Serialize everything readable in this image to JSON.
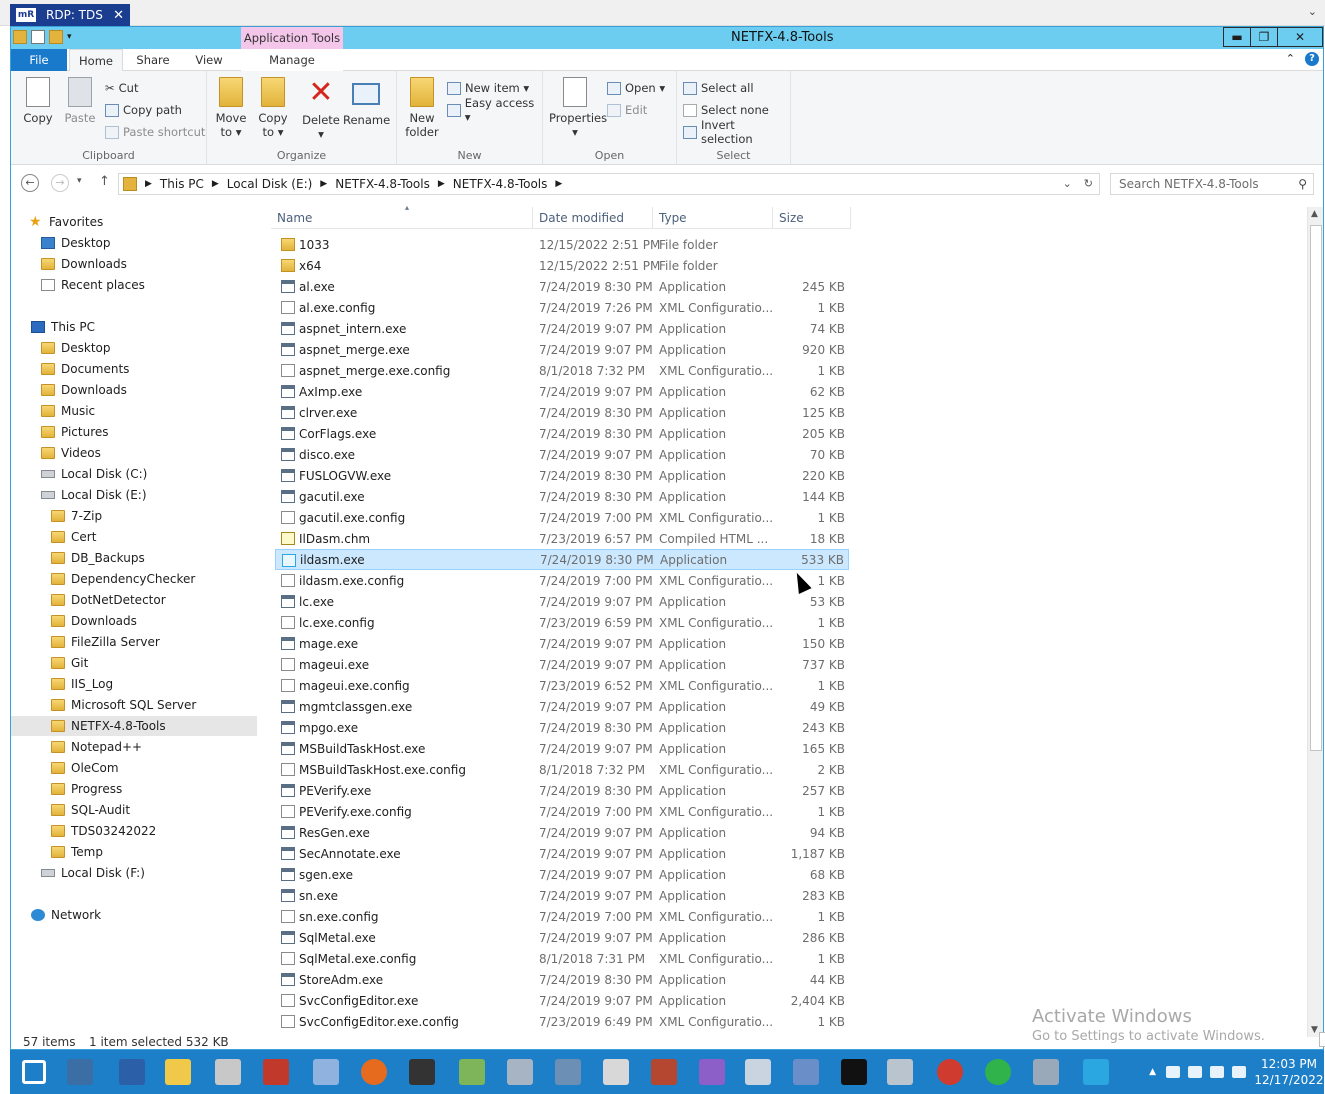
{
  "rdp": {
    "tab_label": "RDP: TDS",
    "logo": "mR",
    "close": "✕",
    "chevron": "⌄"
  },
  "window": {
    "title": "NETFX-4.8-Tools",
    "contextual_tab": "Application Tools",
    "buttons": {
      "minimize": "▬",
      "restore": "❐",
      "close": "✕"
    }
  },
  "tabs": {
    "file": "File",
    "home": "Home",
    "share": "Share",
    "view": "View",
    "manage": "Manage",
    "collapse": "⌃",
    "help": "?"
  },
  "ribbon": {
    "clipboard": {
      "label": "Clipboard",
      "copy": "Copy",
      "paste": "Paste",
      "cut": "Cut",
      "copy_path": "Copy path",
      "paste_shortcut": "Paste shortcut"
    },
    "organize": {
      "label": "Organize",
      "move_to_1": "Move",
      "move_to_2": "to ▾",
      "copy_to_1": "Copy",
      "copy_to_2": "to ▾",
      "delete_1": "Delete",
      "delete_2": "▾",
      "rename": "Rename"
    },
    "new": {
      "label": "New",
      "new_folder_1": "New",
      "new_folder_2": "folder",
      "new_item": "New item ▾",
      "easy_access": "Easy access ▾"
    },
    "open": {
      "label": "Open",
      "properties_1": "Properties",
      "properties_2": "▾",
      "open": "Open ▾",
      "edit": "Edit"
    },
    "select": {
      "label": "Select",
      "select_all": "Select all",
      "select_none": "Select none",
      "invert": "Invert selection"
    }
  },
  "address": {
    "crumbs": [
      "This PC",
      "Local Disk (E:)",
      "NETFX-4.8-Tools",
      "NETFX-4.8-Tools"
    ],
    "search_placeholder": "Search NETFX-4.8-Tools"
  },
  "nav": {
    "favorites": "Favorites",
    "fav_desktop": "Desktop",
    "fav_downloads": "Downloads",
    "fav_recent": "Recent places",
    "thispc": "This PC",
    "pc_desktop": "Desktop",
    "pc_documents": "Documents",
    "pc_downloads": "Downloads",
    "pc_music": "Music",
    "pc_pictures": "Pictures",
    "pc_videos": "Videos",
    "disk_c": "Local Disk (C:)",
    "disk_e": "Local Disk (E:)",
    "e_folders": [
      "7-Zip",
      "Cert",
      "DB_Backups",
      "DependencyChecker",
      "DotNetDetector",
      "Downloads",
      "FileZilla Server",
      "Git",
      "IIS_Log",
      "Microsoft SQL Server",
      "NETFX-4.8-Tools",
      "Notepad++",
      "OleCom",
      "Progress",
      "SQL-Audit",
      "TDS03242022",
      "Temp"
    ],
    "disk_f": "Local Disk (F:)",
    "network": "Network"
  },
  "columns": {
    "name": "Name",
    "date": "Date modified",
    "type": "Type",
    "size": "Size"
  },
  "files": [
    {
      "name": "1033",
      "date": "12/15/2022 2:51 PM",
      "type": "File folder",
      "size": "",
      "icon": "folder"
    },
    {
      "name": "x64",
      "date": "12/15/2022 2:51 PM",
      "type": "File folder",
      "size": "",
      "icon": "folder"
    },
    {
      "name": "al.exe",
      "date": "7/24/2019 8:30 PM",
      "type": "Application",
      "size": "245 KB",
      "icon": "app"
    },
    {
      "name": "al.exe.config",
      "date": "7/24/2019 7:26 PM",
      "type": "XML Configuratio...",
      "size": "1 KB",
      "icon": "cfg"
    },
    {
      "name": "aspnet_intern.exe",
      "date": "7/24/2019 9:07 PM",
      "type": "Application",
      "size": "74 KB",
      "icon": "app"
    },
    {
      "name": "aspnet_merge.exe",
      "date": "7/24/2019 9:07 PM",
      "type": "Application",
      "size": "920 KB",
      "icon": "app"
    },
    {
      "name": "aspnet_merge.exe.config",
      "date": "8/1/2018 7:32 PM",
      "type": "XML Configuratio...",
      "size": "1 KB",
      "icon": "cfg"
    },
    {
      "name": "AxImp.exe",
      "date": "7/24/2019 9:07 PM",
      "type": "Application",
      "size": "62 KB",
      "icon": "app"
    },
    {
      "name": "clrver.exe",
      "date": "7/24/2019 8:30 PM",
      "type": "Application",
      "size": "125 KB",
      "icon": "app"
    },
    {
      "name": "CorFlags.exe",
      "date": "7/24/2019 8:30 PM",
      "type": "Application",
      "size": "205 KB",
      "icon": "app"
    },
    {
      "name": "disco.exe",
      "date": "7/24/2019 9:07 PM",
      "type": "Application",
      "size": "70 KB",
      "icon": "app"
    },
    {
      "name": "FUSLOGVW.exe",
      "date": "7/24/2019 8:30 PM",
      "type": "Application",
      "size": "220 KB",
      "icon": "app"
    },
    {
      "name": "gacutil.exe",
      "date": "7/24/2019 8:30 PM",
      "type": "Application",
      "size": "144 KB",
      "icon": "app"
    },
    {
      "name": "gacutil.exe.config",
      "date": "7/24/2019 7:00 PM",
      "type": "XML Configuratio...",
      "size": "1 KB",
      "icon": "cfg"
    },
    {
      "name": "IlDasm.chm",
      "date": "7/23/2019 6:57 PM",
      "type": "Compiled HTML ...",
      "size": "18 KB",
      "icon": "chm"
    },
    {
      "name": "ildasm.exe",
      "date": "7/24/2019 8:30 PM",
      "type": "Application",
      "size": "533 KB",
      "icon": "bolt",
      "selected": true
    },
    {
      "name": "ildasm.exe.config",
      "date": "7/24/2019 7:00 PM",
      "type": "XML Configuratio...",
      "size": "1 KB",
      "icon": "cfg"
    },
    {
      "name": "lc.exe",
      "date": "7/24/2019 9:07 PM",
      "type": "Application",
      "size": "53 KB",
      "icon": "app"
    },
    {
      "name": "lc.exe.config",
      "date": "7/23/2019 6:59 PM",
      "type": "XML Configuratio...",
      "size": "1 KB",
      "icon": "cfg"
    },
    {
      "name": "mage.exe",
      "date": "7/24/2019 9:07 PM",
      "type": "Application",
      "size": "150 KB",
      "icon": "app"
    },
    {
      "name": "mageui.exe",
      "date": "7/24/2019 9:07 PM",
      "type": "Application",
      "size": "737 KB",
      "icon": "cfg"
    },
    {
      "name": "mageui.exe.config",
      "date": "7/23/2019 6:52 PM",
      "type": "XML Configuratio...",
      "size": "1 KB",
      "icon": "cfg"
    },
    {
      "name": "mgmtclassgen.exe",
      "date": "7/24/2019 9:07 PM",
      "type": "Application",
      "size": "49 KB",
      "icon": "app"
    },
    {
      "name": "mpgo.exe",
      "date": "7/24/2019 8:30 PM",
      "type": "Application",
      "size": "243 KB",
      "icon": "app"
    },
    {
      "name": "MSBuildTaskHost.exe",
      "date": "7/24/2019 9:07 PM",
      "type": "Application",
      "size": "165 KB",
      "icon": "app"
    },
    {
      "name": "MSBuildTaskHost.exe.config",
      "date": "8/1/2018 7:32 PM",
      "type": "XML Configuratio...",
      "size": "2 KB",
      "icon": "cfg"
    },
    {
      "name": "PEVerify.exe",
      "date": "7/24/2019 8:30 PM",
      "type": "Application",
      "size": "257 KB",
      "icon": "app"
    },
    {
      "name": "PEVerify.exe.config",
      "date": "7/24/2019 7:00 PM",
      "type": "XML Configuratio...",
      "size": "1 KB",
      "icon": "cfg"
    },
    {
      "name": "ResGen.exe",
      "date": "7/24/2019 9:07 PM",
      "type": "Application",
      "size": "94 KB",
      "icon": "app"
    },
    {
      "name": "SecAnnotate.exe",
      "date": "7/24/2019 9:07 PM",
      "type": "Application",
      "size": "1,187 KB",
      "icon": "app"
    },
    {
      "name": "sgen.exe",
      "date": "7/24/2019 9:07 PM",
      "type": "Application",
      "size": "68 KB",
      "icon": "app"
    },
    {
      "name": "sn.exe",
      "date": "7/24/2019 9:07 PM",
      "type": "Application",
      "size": "283 KB",
      "icon": "app"
    },
    {
      "name": "sn.exe.config",
      "date": "7/24/2019 7:00 PM",
      "type": "XML Configuratio...",
      "size": "1 KB",
      "icon": "cfg"
    },
    {
      "name": "SqlMetal.exe",
      "date": "7/24/2019 9:07 PM",
      "type": "Application",
      "size": "286 KB",
      "icon": "app"
    },
    {
      "name": "SqlMetal.exe.config",
      "date": "8/1/2018 7:31 PM",
      "type": "XML Configuratio...",
      "size": "1 KB",
      "icon": "cfg"
    },
    {
      "name": "StoreAdm.exe",
      "date": "7/24/2019 8:30 PM",
      "type": "Application",
      "size": "44 KB",
      "icon": "app"
    },
    {
      "name": "SvcConfigEditor.exe",
      "date": "7/24/2019 9:07 PM",
      "type": "Application",
      "size": "2,404 KB",
      "icon": "cfg"
    },
    {
      "name": "SvcConfigEditor.exe.config",
      "date": "7/23/2019 6:49 PM",
      "type": "XML Configuratio...",
      "size": "1 KB",
      "icon": "cfg"
    }
  ],
  "status": {
    "items": "57 items",
    "selected": "1 item selected  532 KB"
  },
  "watermark": {
    "line1": "Activate Windows",
    "line2": "Go to Settings to activate Windows."
  },
  "taskbar": {
    "icons": [
      "start-icon",
      "server-manager-icon",
      "powershell-icon",
      "file-explorer-icon",
      "admin-tools-icon",
      "toolbox-icon",
      "registry-icon",
      "firefox-icon",
      "remote-desktop-icon",
      "notepadpp-icon",
      "computer-management-icon",
      "network-icon",
      "task-scheduler-icon",
      "firewall-icon",
      "git-icon",
      "control-panel-icon",
      "installer-icon",
      "cmd-icon",
      "performance-icon",
      "compass-icon",
      "jd-gui-icon",
      "services-icon",
      "ildasm-icon"
    ],
    "time": "12:03 PM",
    "date": "12/17/2022"
  },
  "colors": {
    "titlebar": "#6ccdf0",
    "file_tab": "#1979ca",
    "taskbar": "#1d7fc8",
    "selection": "#cce8ff",
    "app_tools": "#f3c6ea"
  }
}
